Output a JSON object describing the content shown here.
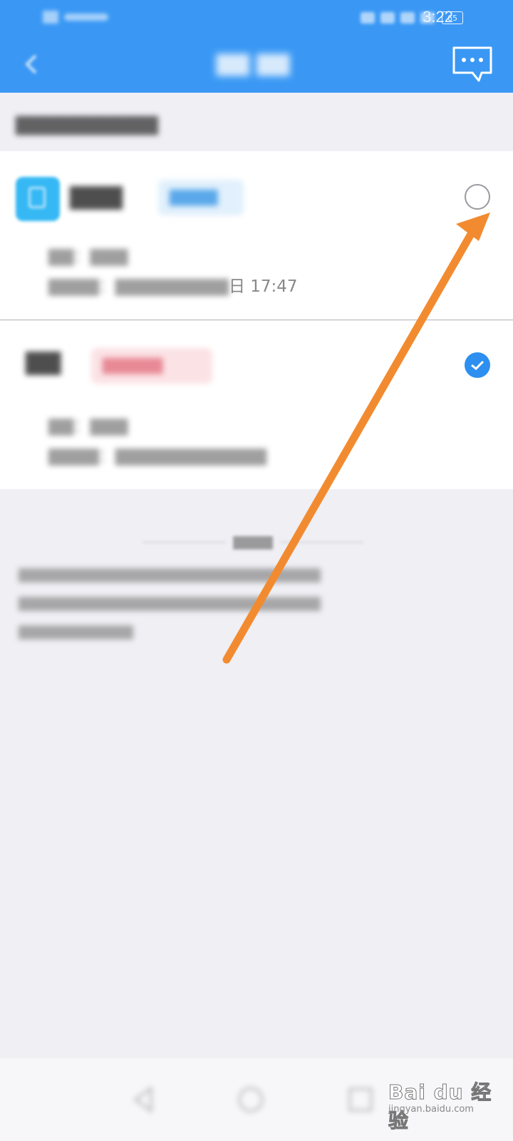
{
  "status_bar": {
    "time": "3:22",
    "battery": "65"
  },
  "cards": [
    {
      "time_suffix": "日 17:47"
    }
  ],
  "watermark": {
    "brand": "Bai du 经验",
    "url": "jingyan.baidu.com"
  },
  "colors": {
    "primary_blue": "#3a98f4",
    "arrow_orange": "#f28b30",
    "selected_radio": "#2d8ff0",
    "page_background": "#efeff4"
  }
}
